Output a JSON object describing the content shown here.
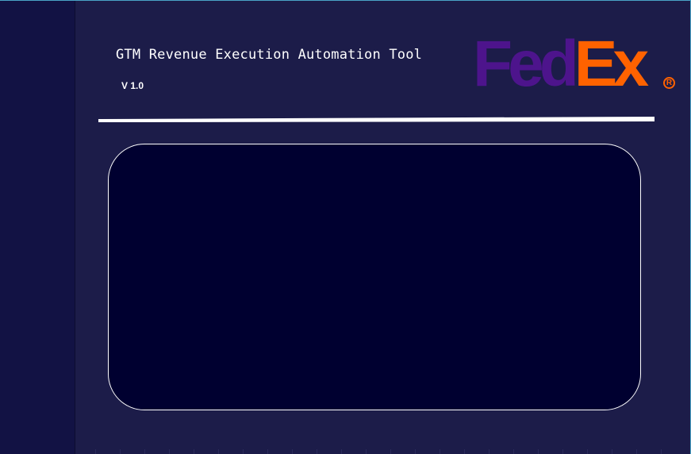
{
  "header": {
    "title": "GTM Revenue Execution Automation Tool",
    "version": "V 1.0"
  },
  "logo": {
    "part1": "Fed",
    "part2": "Ex",
    "registered_mark": "R",
    "colors": {
      "fed": "#4d148c",
      "ex": "#ff6200"
    }
  },
  "colors": {
    "background": "#1c1c49",
    "sidebar": "#121244",
    "panel": "#000030",
    "divider": "#ffffff"
  }
}
